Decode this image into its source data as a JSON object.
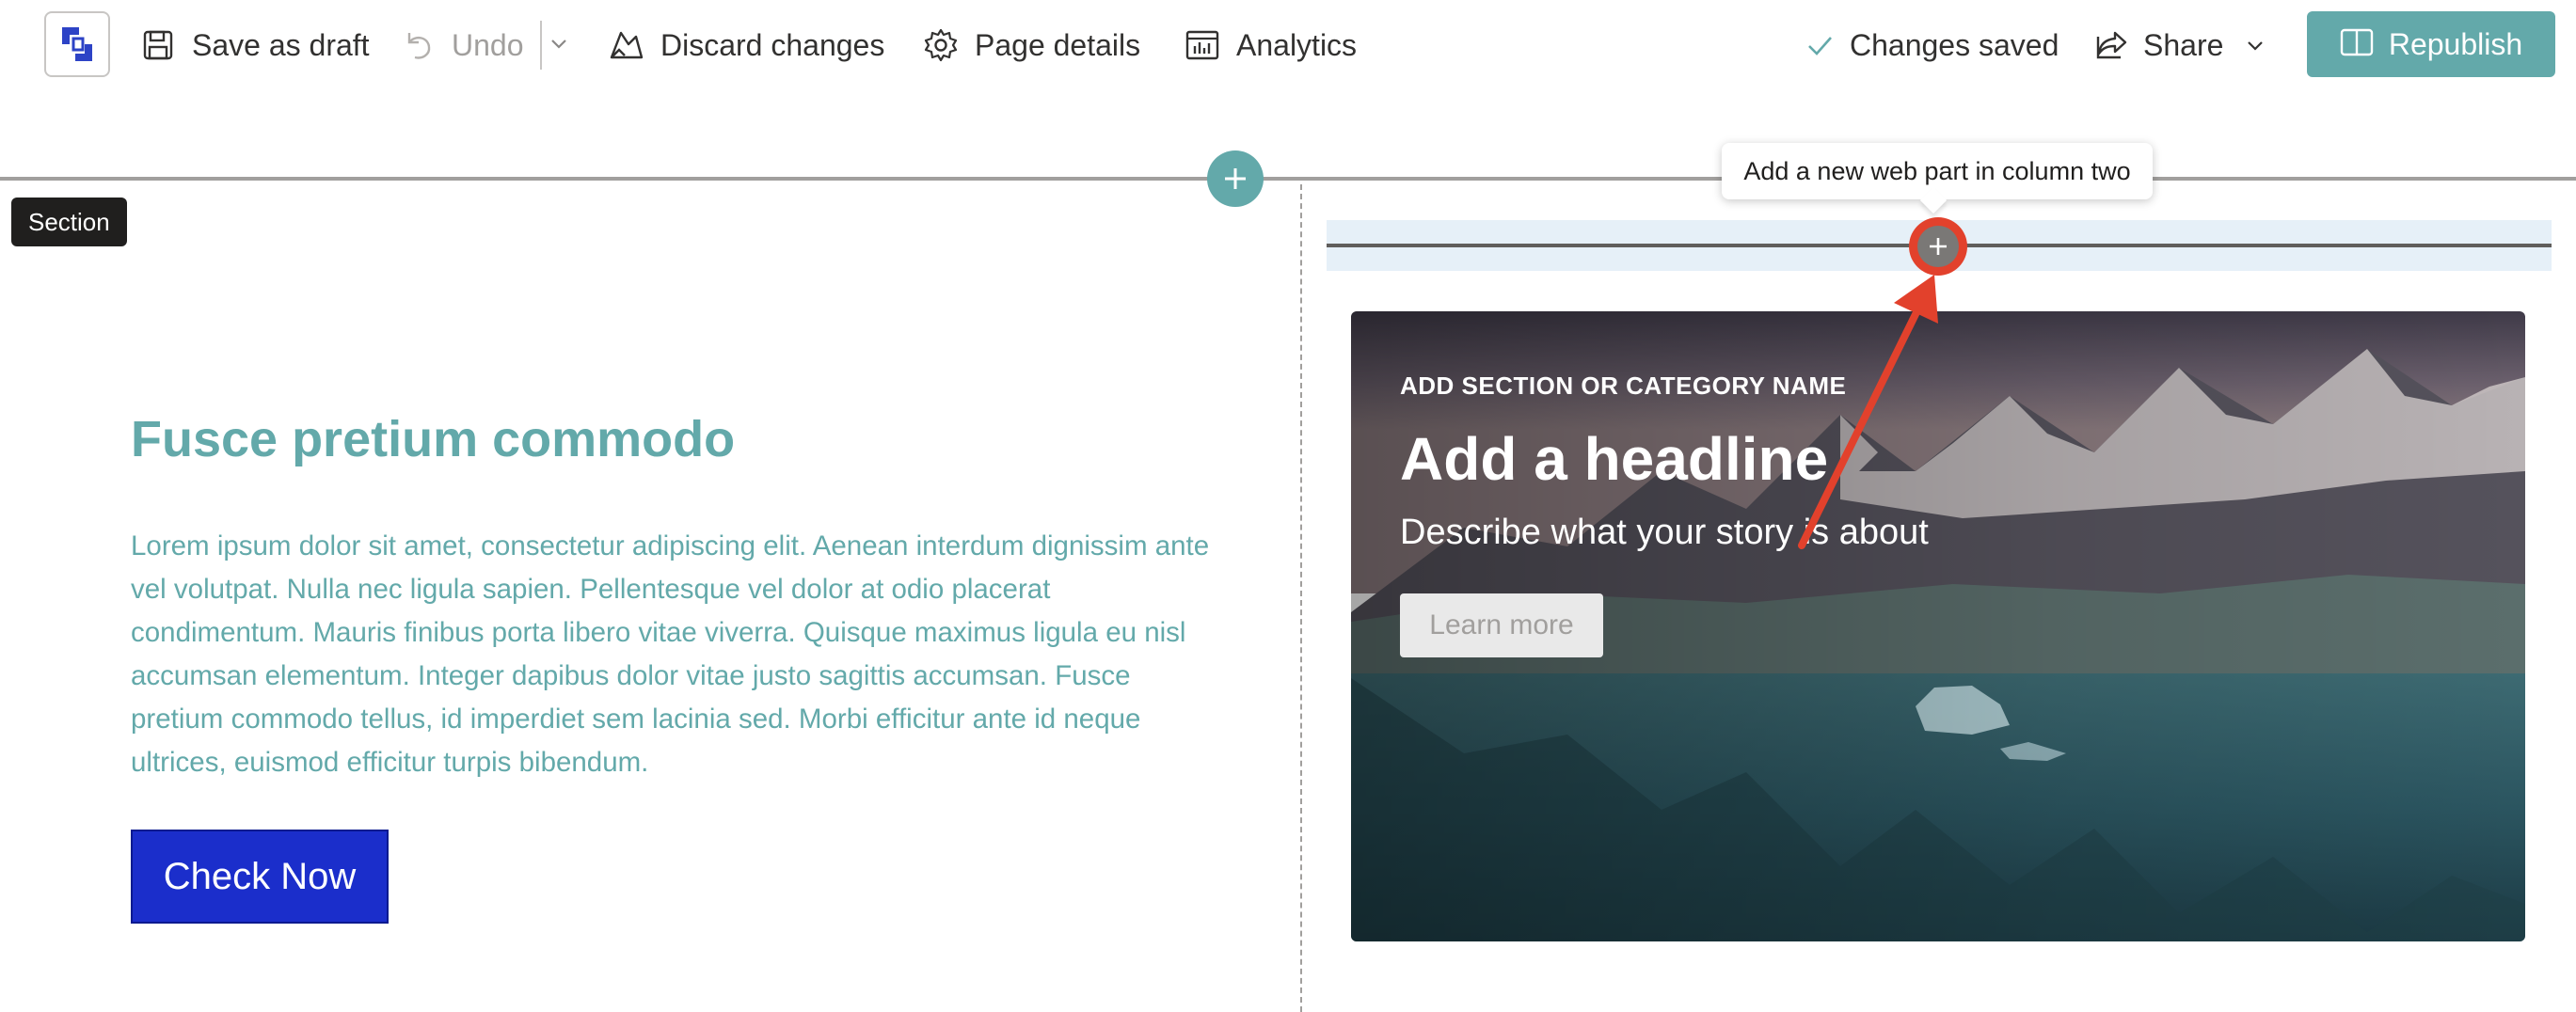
{
  "toolbar": {
    "save_draft_label": "Save as draft",
    "undo_label": "Undo",
    "discard_label": "Discard changes",
    "page_details_label": "Page details",
    "analytics_label": "Analytics",
    "status_label": "Changes saved",
    "share_label": "Share",
    "republish_label": "Republish"
  },
  "canvas": {
    "section_tag": "Section",
    "tooltip": "Add a new web part in column two"
  },
  "left_column": {
    "title": "Fusce pretium commodo",
    "body": "Lorem ipsum dolor sit amet, consectetur adipiscing elit. Aenean interdum dignissim ante vel volutpat. Nulla nec ligula sapien. Pellentesque vel dolor at odio placerat condimentum. Mauris finibus porta libero vitae viverra. Quisque maximus ligula eu nisl accumsan elementum. Integer dapibus dolor vitae justo sagittis accumsan. Fusce pretium commodo tellus, id imperdiet sem lacinia sed. Morbi efficitur ante id neque ultrices, euismod efficitur turpis bibendum.",
    "button_label": "Check Now"
  },
  "hero": {
    "eyebrow": "ADD SECTION OR CATEGORY NAME",
    "headline": "Add a headline",
    "description": "Describe what your story is about",
    "button_label": "Learn more"
  },
  "colors": {
    "accent": "#63a9aa",
    "primary_button": "#1b2ecb",
    "annotation": "#e2412c"
  },
  "icons": {
    "logo": "app-logo-icon",
    "save": "save-icon",
    "undo": "undo-icon",
    "undo_menu": "chevron-down-icon",
    "discard": "discard-icon",
    "page_details": "gear-icon",
    "analytics": "analytics-icon",
    "status": "checkmark-icon",
    "share": "share-icon",
    "share_menu": "chevron-down-icon",
    "republish": "book-icon",
    "add": "plus-icon"
  }
}
